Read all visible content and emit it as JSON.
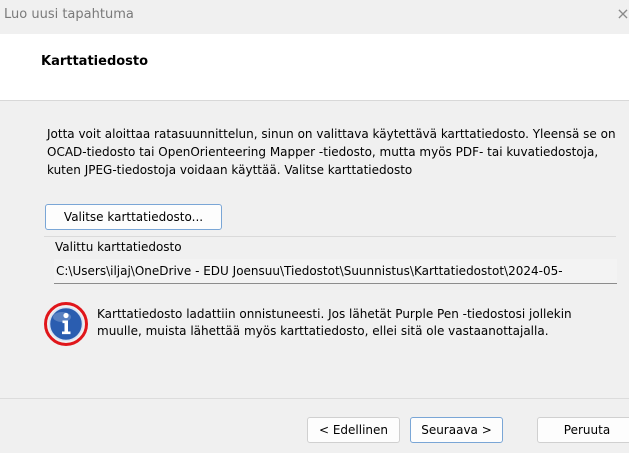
{
  "window": {
    "title": "Luo uusi tapahtuma",
    "close_glyph": "×"
  },
  "header": {
    "title": "Karttatiedosto"
  },
  "main": {
    "instructions": "Jotta voit aloittaa ratasuunnittelun, sinun on valittava käytettävä karttatiedosto. Yleensä se on OCAD-tiedosto tai OpenOrienteering Mapper -tiedosto, mutta myös PDF- tai kuvatiedostoja, kuten JPEG-tiedostoja voidaan käyttää. Valitse karttatiedosto",
    "select_button_label": "Valitse karttatiedosto...",
    "selected_group_label": "Valittu karttatiedosto",
    "selected_path": "C:\\Users\\iljaj\\OneDrive - EDU Joensuu\\Tiedostot\\Suunnistus\\Karttatiedostot\\2024-05-",
    "info_icon": "info-icon",
    "info_message": "Karttatiedosto ladattiin onnistuneesti. Jos lähetät Purple Pen -tiedostosi jollekin muulle, muista lähettää myös karttatiedosto, ellei sitä ole vastaanottajalla."
  },
  "footer": {
    "prev_label": "< Edellinen",
    "next_label": "Seuraava >",
    "cancel_label": "Peruuta"
  },
  "colors": {
    "background": "#f0f0f0",
    "header_background": "#ffffff",
    "primary_button_border": "#7aa6d6",
    "info_icon_blue": "#2a5db0",
    "info_icon_highlight_ring": "#e0161b"
  }
}
